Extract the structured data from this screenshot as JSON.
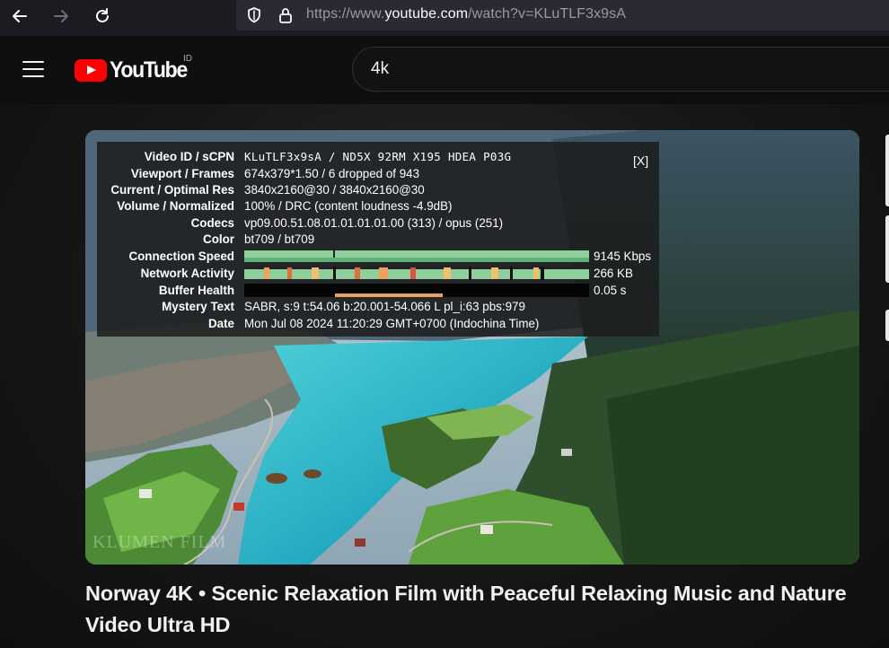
{
  "browser": {
    "url_prefix": "https://www.",
    "url_host": "youtube.com",
    "url_path": "/watch?v=KLuTLF3x9sA"
  },
  "masthead": {
    "logo_text": "YouTube",
    "country_code": "ID",
    "search_value": "4k"
  },
  "stats": {
    "close_label": "[X]",
    "rows": [
      {
        "label": "Video ID / sCPN",
        "value": "KLuTLF3x9sA / ND5X 92RM X195 HDEA P03G"
      },
      {
        "label": "Viewport / Frames",
        "value": "674x379*1.50 / 6 dropped of 943"
      },
      {
        "label": "Current / Optimal Res",
        "value": "3840x2160@30 / 3840x2160@30"
      },
      {
        "label": "Volume / Normalized",
        "value": "100% / DRC (content loudness -4.9dB)"
      },
      {
        "label": "Codecs",
        "value": "vp09.00.51.08.01.01.01.01.00 (313) / opus (251)"
      },
      {
        "label": "Color",
        "value": "bt709 / bt709"
      },
      {
        "label": "Connection Speed",
        "value": "9145 Kbps"
      },
      {
        "label": "Network Activity",
        "value": "266 KB"
      },
      {
        "label": "Buffer Health",
        "value": "0.05 s"
      },
      {
        "label": "Mystery Text",
        "value": "SABR, s:9 t:54.06 b:20.001-54.066 L pl_i:63 pbs:979"
      },
      {
        "label": "Date",
        "value": "Mon Jul 08 2024 11:20:29 GMT+0700 (Indochina Time)"
      }
    ]
  },
  "video": {
    "watermark": "KLUMEN FILM",
    "title": "Norway 4K • Scenic Relaxation Film with Peaceful Relaxing Music and Nature Video Ultra HD"
  },
  "colors": {
    "youtube_red": "#ff0000",
    "graph_green": "#8fcf9b",
    "graph_orange": "#f0a060"
  },
  "icons": [
    "back-arrow-icon",
    "forward-arrow-icon",
    "reload-icon",
    "shield-icon",
    "lock-icon",
    "hamburger-menu-icon",
    "youtube-logo-icon"
  ]
}
